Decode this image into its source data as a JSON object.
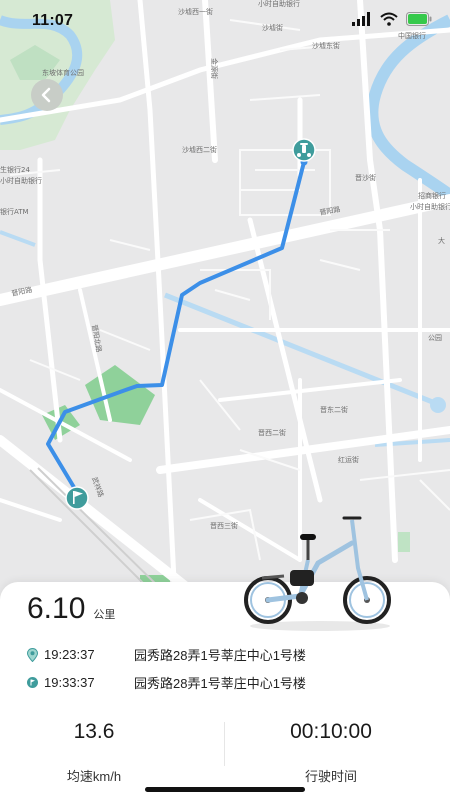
{
  "status_bar": {
    "time": "11:07"
  },
  "map": {
    "labels": {
      "park": "东坡体育公园",
      "shaxia_xi_1": "沙墟西一街",
      "shaxia_xi_2": "沙墟西二街",
      "atm_24h": "小时自助银行",
      "bank_china": "中国银行",
      "shaxia_street": "沙墟街",
      "shaxia_east": "沙墟东街",
      "jinyuan": "金源街",
      "bank24": "生银行24",
      "bank24b": "小时自助银行",
      "atm": "银行ATM",
      "jinyang_road_a": "晋阳路",
      "jinyang_road_b": "晋阳路",
      "zhaoshang": "招商银行",
      "zhaoshang_b": "小时自助银行",
      "jinsha": "晋沙街",
      "jinyang_north": "晋阳北路",
      "jindong_2": "晋东二街",
      "jinxi_2": "晋西二街",
      "honghua": "红运街",
      "wuxiang": "武祥路",
      "jinxi_3": "晋西三街",
      "da": "大",
      "gongyuan": "公园"
    }
  },
  "summary": {
    "distance_value": "6.10",
    "distance_unit": "公里",
    "start": {
      "time": "19:23:37",
      "address": "园秀路28弄1号莘庄中心1号楼"
    },
    "end": {
      "time": "19:33:37",
      "address": "园秀路28弄1号莘庄中心1号楼"
    },
    "avg_speed": {
      "value": "13.6",
      "label": "均速km/h"
    },
    "duration": {
      "value": "00:10:00",
      "label": "行驶时间"
    }
  },
  "colors": {
    "route": "#3c8fe8",
    "marker": "#3f9c9c",
    "green": "#7ec98a",
    "water": "#a9d3f0"
  },
  "icons": {
    "back": "chevron-left-icon",
    "start": "scooter-icon",
    "end": "flag-icon"
  }
}
